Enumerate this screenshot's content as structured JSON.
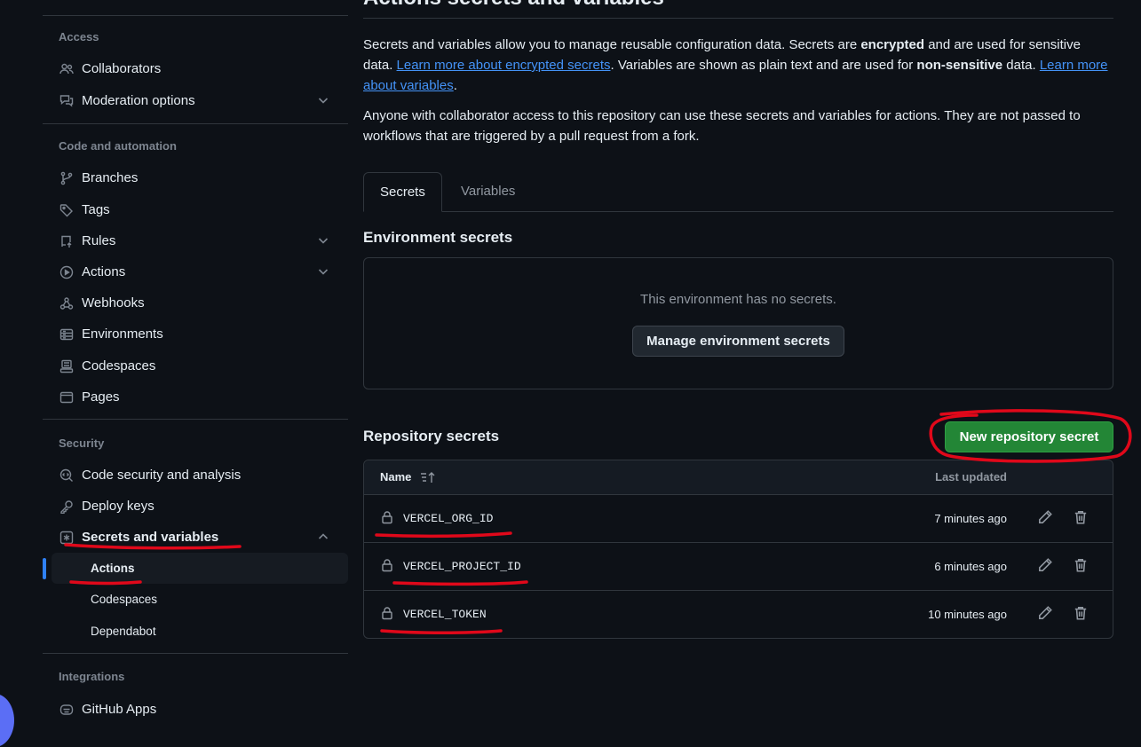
{
  "sidebar": {
    "access": {
      "header": "Access",
      "items": [
        {
          "label": "Collaborators"
        },
        {
          "label": "Moderation options"
        }
      ]
    },
    "code": {
      "header": "Code and automation",
      "items": [
        {
          "label": "Branches"
        },
        {
          "label": "Tags"
        },
        {
          "label": "Rules"
        },
        {
          "label": "Actions"
        },
        {
          "label": "Webhooks"
        },
        {
          "label": "Environments"
        },
        {
          "label": "Codespaces"
        },
        {
          "label": "Pages"
        }
      ]
    },
    "security": {
      "header": "Security",
      "items": [
        {
          "label": "Code security and analysis"
        },
        {
          "label": "Deploy keys"
        },
        {
          "label": "Secrets and variables"
        }
      ],
      "sub_items": [
        {
          "label": "Actions"
        },
        {
          "label": "Codespaces"
        },
        {
          "label": "Dependabot"
        }
      ]
    },
    "integrations": {
      "header": "Integrations",
      "items": [
        {
          "label": "GitHub Apps"
        }
      ]
    }
  },
  "main": {
    "title": "Actions secrets and variables",
    "intro": {
      "p1_a": "Secrets and variables allow you to manage reusable configuration data. Secrets are ",
      "p1_b": "encrypted",
      "p1_c": " and are used for sensitive data. ",
      "p1_link1": "Learn more about encrypted secrets",
      "p1_d": ". Variables are shown as plain text and are used for ",
      "p1_e": "non-sensitive",
      "p1_f": " data. ",
      "p1_link2": "Learn more about variables",
      "p1_g": ".",
      "p2": "Anyone with collaborator access to this repository can use these secrets and variables for actions. They are not passed to workflows that are triggered by a pull request from a fork."
    },
    "tabs": [
      {
        "label": "Secrets"
      },
      {
        "label": "Variables"
      }
    ],
    "environment": {
      "heading": "Environment secrets",
      "empty_message": "This environment has no secrets.",
      "manage_button": "Manage environment secrets"
    },
    "repository": {
      "heading": "Repository secrets",
      "new_button": "New repository secret",
      "columns": {
        "name": "Name",
        "last_updated": "Last updated"
      },
      "rows": [
        {
          "name": "VERCEL_ORG_ID",
          "updated": "7 minutes ago"
        },
        {
          "name": "VERCEL_PROJECT_ID",
          "updated": "6 minutes ago"
        },
        {
          "name": "VERCEL_TOKEN",
          "updated": "10 minutes ago"
        }
      ]
    }
  },
  "colors": {
    "background": "#0d1117",
    "accent_blue": "#2f81f7",
    "link": "#4493f8",
    "primary_green": "#238636",
    "annotation_red": "#e0081a"
  }
}
